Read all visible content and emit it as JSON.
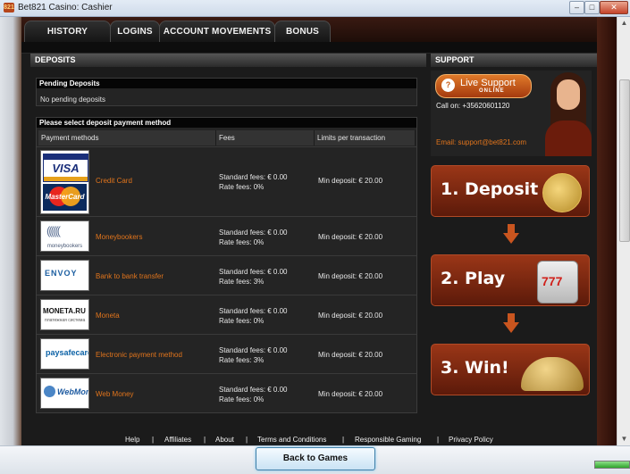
{
  "window": {
    "title": "Bet821 Casino: Cashier",
    "icon_label": "821"
  },
  "tabs": [
    {
      "label": "HISTORY"
    },
    {
      "label": "LOGINS"
    },
    {
      "label": "ACCOUNT MOVEMENTS"
    },
    {
      "label": "BONUS"
    }
  ],
  "deposits": {
    "section_title": "DEPOSITS",
    "pending_title": "Pending Deposits",
    "pending_text": "No pending deposits",
    "select_title": "Please select deposit payment method",
    "columns": [
      "Payment methods",
      "Fees",
      "Limits per transaction"
    ],
    "methods": [
      {
        "name": "Credit Card",
        "fee1": "Standard fees: € 0.00",
        "fee2": "Rate fees: 0%",
        "limit": "Min deposit: € 20.00",
        "logo_top": "VISA",
        "logo_bottom": "MasterCard"
      },
      {
        "name": "Moneybookers",
        "fee1": "Standard fees: € 0.00",
        "fee2": "Rate fees: 0%",
        "limit": "Min deposit: € 20.00",
        "logo_mark": "((((((",
        "logo_text": "moneybookers"
      },
      {
        "name": "Bank to bank transfer",
        "fee1": "Standard fees: € 0.00",
        "fee2": "Rate fees: 3%",
        "limit": "Min deposit: € 20.00",
        "logo_text": "ENVOY"
      },
      {
        "name": "Moneta",
        "fee1": "Standard fees: € 0.00",
        "fee2": "Rate fees: 0%",
        "limit": "Min deposit: € 20.00",
        "logo_text": "MONETA.RU",
        "logo_sub": "платежная система"
      },
      {
        "name": "Electronic payment method",
        "fee1": "Standard fees: € 0.00",
        "fee2": "Rate fees: 3%",
        "limit": "Min deposit: € 20.00",
        "logo_text": "paysafecard"
      },
      {
        "name": "Web Money",
        "fee1": "Standard fees: € 0.00",
        "fee2": "Rate fees: 0%",
        "limit": "Min deposit: € 20.00",
        "logo_text": "WebMoney"
      }
    ]
  },
  "support": {
    "section_title": "SUPPORT",
    "live_label": "Live Support",
    "live_sub": "ONLINE",
    "call": "Call on: +35620601120",
    "email": "Email: support@bet821.com",
    "steps": [
      "1. Deposit",
      "2. Play",
      "3. Win!"
    ],
    "slot_digits": "777"
  },
  "footer": {
    "links": [
      "Help",
      "Affiliates",
      "About",
      "Terms and Conditions",
      "Responsible Gaming",
      "Privacy Policy"
    ],
    "separator": "|"
  },
  "bottom": {
    "back_label": "Back to Games"
  },
  "colors": {
    "accent_orange": "#e0741c",
    "step_red": "#9a3617",
    "panel_dark": "#242424"
  }
}
